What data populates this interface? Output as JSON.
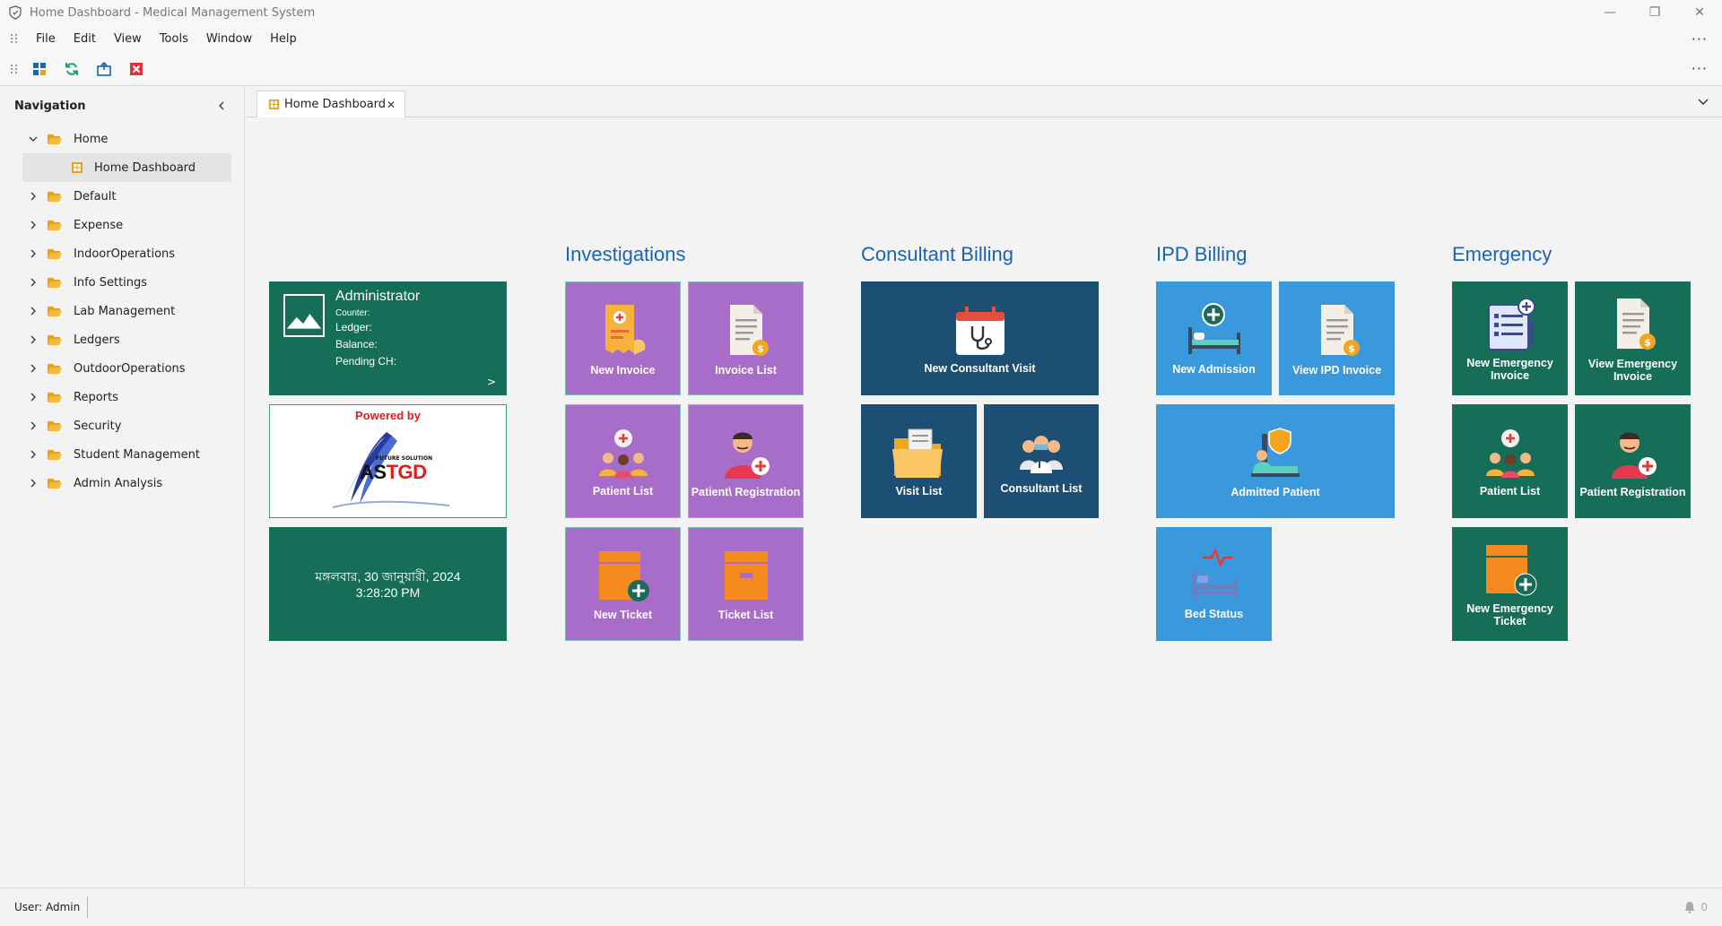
{
  "window": {
    "title": "Home Dashboard - Medical Management System",
    "controls": {
      "minimize": "—",
      "restore": "❐",
      "close": "✕"
    }
  },
  "menu": [
    "File",
    "Edit",
    "View",
    "Tools",
    "Window",
    "Help"
  ],
  "more": "···",
  "sidebar": {
    "title": "Navigation",
    "items": [
      {
        "label": "Home",
        "expanded": true
      },
      {
        "label": "Default"
      },
      {
        "label": "Expense"
      },
      {
        "label": "IndoorOperations"
      },
      {
        "label": "Info Settings"
      },
      {
        "label": "Lab Management"
      },
      {
        "label": "Ledgers"
      },
      {
        "label": "OutdoorOperations"
      },
      {
        "label": "Reports"
      },
      {
        "label": "Security"
      },
      {
        "label": "Student Management"
      },
      {
        "label": "Admin Analysis"
      }
    ],
    "home_child": "Home Dashboard"
  },
  "tab": {
    "label": "Home Dashboard",
    "close": "✕"
  },
  "admin": {
    "name": "Administrator",
    "counter": "Counter:",
    "ledger": "Ledger:",
    "balance": "Balance:",
    "pending": "Pending CH:",
    "go": ">"
  },
  "logo": {
    "powered": "Powered by",
    "tagline": "FUTURE SOLUTION",
    "brand_a": "AS",
    "brand_b": "TGD"
  },
  "clock": {
    "date": "মঙ্গলবার, 30 জানুয়ারী, 2024",
    "time": "3:28:20 PM"
  },
  "groups": {
    "investigations": {
      "title": "Investigations",
      "tiles": [
        "New Invoice",
        "Invoice List",
        "Patient List",
        "Patient\\ Registration",
        "New Ticket",
        "Ticket List"
      ]
    },
    "consultant": {
      "title": "Consultant Billing",
      "tiles": [
        "New Consultant Visit",
        "Visit List",
        "Consultant List"
      ]
    },
    "ipd": {
      "title": "IPD Billing",
      "tiles": [
        "New Admission",
        "View IPD Invoice",
        "Admitted Patient",
        "Bed Status"
      ]
    },
    "emergency": {
      "title": "Emergency",
      "tiles": [
        "New Emergency Invoice",
        "View Emergency Invoice",
        "Patient List",
        "Patient Registration",
        "New Emergency Ticket"
      ]
    }
  },
  "status": {
    "user": "User: Admin",
    "notifications": "0"
  },
  "colors": {
    "purple": "#a86cc9",
    "navy": "#1d4e73",
    "sky": "#3a99dc",
    "teal": "#166d58",
    "accent": "#1a64b4"
  }
}
